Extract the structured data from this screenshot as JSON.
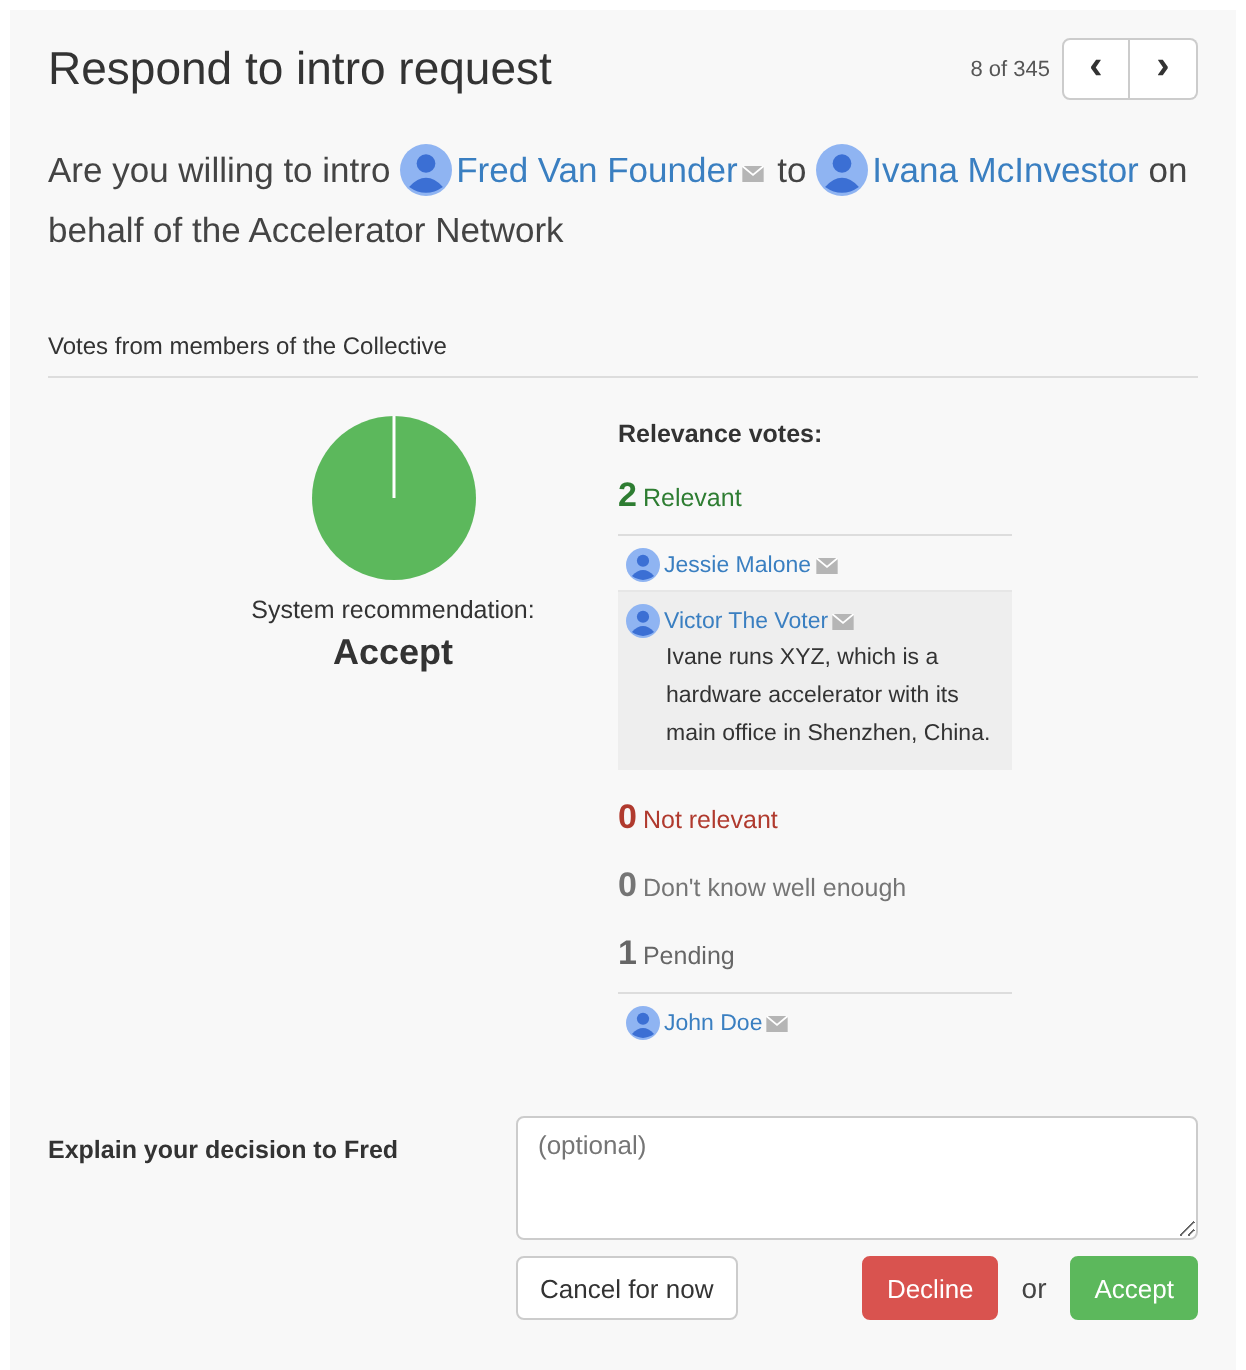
{
  "title": "Respond to intro request",
  "pager": {
    "position": "8 of 345",
    "prev": "‹",
    "next": "›"
  },
  "question": {
    "before": "Are you willing to intro",
    "from": {
      "name": "Fred Van Founder",
      "mail": true
    },
    "middle": "to",
    "to": {
      "name": "Ivana McInvestor",
      "mail": false
    },
    "after": "on behalf of the Accelerator Network"
  },
  "votes_heading": "Votes from members of the Collective",
  "recommendation": {
    "label": "System recommendation:",
    "value": "Accept"
  },
  "relevance": {
    "heading": "Relevance votes:",
    "groups": [
      {
        "kind": "relevant",
        "count": "2",
        "label": "Relevant",
        "voters": [
          {
            "name": "Jessie Malone"
          },
          {
            "name": "Victor The Voter",
            "comment": "Ivane runs XYZ, which is a hardware accelerator with its main office in Shenzhen, China."
          }
        ]
      },
      {
        "kind": "not_relevant",
        "count": "0",
        "label": "Not relevant"
      },
      {
        "kind": "unsure",
        "count": "0",
        "label": "Don't know well enough"
      },
      {
        "kind": "pending",
        "count": "1",
        "label": "Pending",
        "voters": [
          {
            "name": "John Doe"
          }
        ]
      }
    ]
  },
  "explain": {
    "label": "Explain your decision to Fred",
    "placeholder": "(optional)"
  },
  "buttons": {
    "cancel": "Cancel for now",
    "decline": "Decline",
    "or": "or",
    "accept": "Accept"
  }
}
